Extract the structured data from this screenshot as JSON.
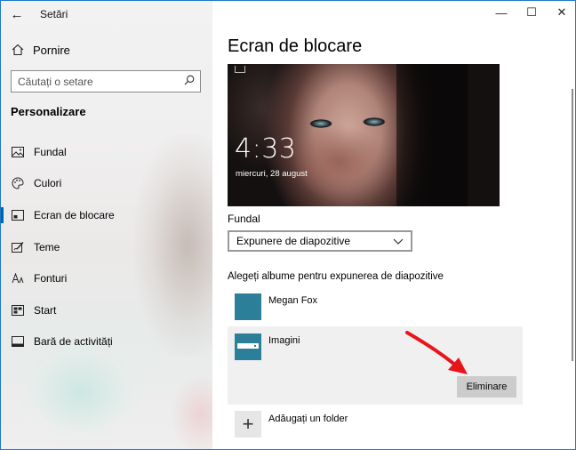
{
  "window": {
    "title": "Setări",
    "minimize_glyph": "—",
    "maximize_glyph": "☐",
    "close_glyph": "✕"
  },
  "nav_back": {
    "glyph": "←"
  },
  "home": {
    "label": "Pornire"
  },
  "search": {
    "placeholder": "Căutați o setare"
  },
  "section": {
    "title": "Personalizare"
  },
  "sidebar": {
    "items": [
      {
        "label": "Fundal",
        "icon": "picture-icon"
      },
      {
        "label": "Culori",
        "icon": "palette-icon"
      },
      {
        "label": "Ecran de blocare",
        "icon": "lock-screen-icon",
        "active": true
      },
      {
        "label": "Teme",
        "icon": "theme-icon"
      },
      {
        "label": "Fonturi",
        "icon": "font-icon"
      },
      {
        "label": "Start",
        "icon": "start-icon"
      },
      {
        "label": "Bară de activități",
        "icon": "taskbar-icon"
      }
    ]
  },
  "main": {
    "title": "Ecran de blocare",
    "preview": {
      "time": "4:33",
      "date": "miercuri, 28 august"
    },
    "background": {
      "label": "Fundal",
      "selected": "Expunere de diapozitive"
    },
    "albums": {
      "label": "Alegeți albume pentru expunerea de diapozitive",
      "items": [
        {
          "name": "Megan Fox"
        },
        {
          "name": "Imagini",
          "selected": true
        }
      ],
      "remove_label": "Eliminare",
      "add_label": "Adăugați un folder"
    }
  },
  "colors": {
    "accent": "#0063b1",
    "album_thumb": "#2c7f98",
    "arrow": "#e8141b"
  }
}
